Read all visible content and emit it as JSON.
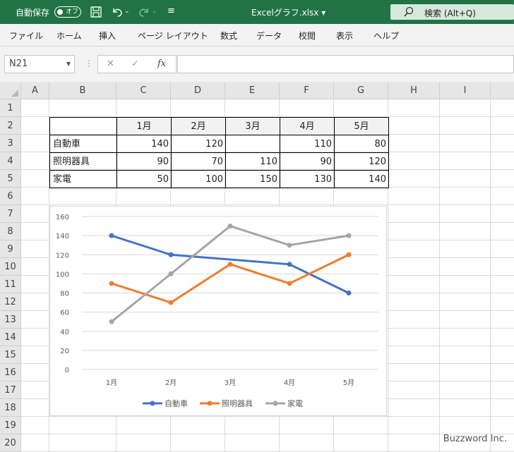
{
  "titlebar": {
    "autosave_label": "自動保存",
    "autosave_state": "オフ",
    "filename": "Excelグラフ.xlsx",
    "search_label": "検索 (Alt+Q)",
    "color": "#217346"
  },
  "menu": {
    "tabs": [
      "ファイル",
      "ホーム",
      "挿入",
      "ページ レイアウト",
      "数式",
      "データ",
      "校閲",
      "表示",
      "ヘルプ"
    ]
  },
  "formula_bar": {
    "name_box": "N21",
    "cancel_icon": "close-icon",
    "enter_icon": "check-icon",
    "fx_label": "fx",
    "formula": ""
  },
  "sheet": {
    "columns": [
      "A",
      "B",
      "C",
      "D",
      "E",
      "F",
      "G",
      "H",
      "I"
    ],
    "rows": [
      "1",
      "2",
      "3",
      "4",
      "5",
      "6",
      "7",
      "8",
      "9",
      "10",
      "11",
      "12",
      "13",
      "14",
      "15",
      "16",
      "17",
      "18",
      "19",
      "20"
    ],
    "table": {
      "headers": [
        "1月",
        "2月",
        "3月",
        "4月",
        "5月"
      ],
      "rows": [
        {
          "label": "自動車",
          "values": [
            "140",
            "120",
            "",
            "110",
            "80"
          ]
        },
        {
          "label": "照明器具",
          "values": [
            "90",
            "70",
            "110",
            "90",
            "120"
          ]
        },
        {
          "label": "家電",
          "values": [
            "50",
            "100",
            "150",
            "130",
            "140"
          ]
        }
      ]
    }
  },
  "chart_data": {
    "type": "line",
    "categories": [
      "1月",
      "2月",
      "3月",
      "4月",
      "5月"
    ],
    "series": [
      {
        "name": "自動車",
        "values": [
          140,
          120,
          null,
          110,
          80
        ],
        "color": "#4472c4"
      },
      {
        "name": "照明器具",
        "values": [
          90,
          70,
          110,
          90,
          120
        ],
        "color": "#ed7d31"
      },
      {
        "name": "家電",
        "values": [
          50,
          100,
          150,
          130,
          140
        ],
        "color": "#a5a5a5"
      }
    ],
    "ylim": [
      0,
      160
    ],
    "yticks": [
      "0",
      "20",
      "40",
      "60",
      "80",
      "100",
      "120",
      "140",
      "160"
    ],
    "grid": true,
    "legend": "bottom",
    "gaps": "connected"
  },
  "watermark": "Buzzword Inc."
}
